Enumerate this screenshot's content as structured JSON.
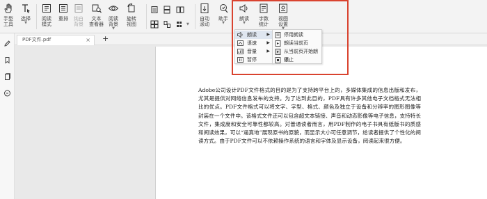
{
  "toolbar": {
    "hand_tool": "手型\n工具",
    "select": "选择",
    "read_mode": "阅读\n模式",
    "reflow": "重排",
    "page_bg": "纯白\n背景",
    "text_viewer": "文本\n查看器",
    "read_bg": "阅读\n背景",
    "rotate_view": "旋转\n视图",
    "auto_scroll": "自动\n滚动",
    "assistant": "助手",
    "read_aloud": "朗读",
    "word_count": "字数\n统计",
    "view_settings": "视图\n设置"
  },
  "read_menu": {
    "items": [
      {
        "label": "朗读",
        "has_submenu": true
      },
      {
        "label": "语速",
        "has_submenu": true
      },
      {
        "label": "音量",
        "has_submenu": true
      },
      {
        "label": "暂停",
        "has_submenu": false
      }
    ]
  },
  "read_submenu": {
    "items": [
      {
        "label": "停用朗读"
      },
      {
        "label": "朗读当前页"
      },
      {
        "label": "从当前页开始朗读"
      },
      {
        "label": "停止"
      }
    ]
  },
  "tabs": {
    "file_name": "PDF文件.pdf",
    "close": "×",
    "add": "+"
  },
  "document": {
    "paragraph": "Adobe公司设计PDF文件格式的目的是为了支持跨平台上的，多媒体集成的信息出版和发布，尤其是提供对网络信息发布的支持。为了达到此目的，PDF具有许多其他电子文档格式无法相比的优点。PDF文件格式可以将文字、字型、格式、颜色及独立于设备和分辨率的图形图像等封装在一个文件中。该格式文件还可以包含超文本链接、声音和动态影像等电子信息，支持特长文件，集成度和安全可靠性都较高。对普通读者而言，用PDF制作的电子书具有纸版书的质感和阅读效果，可以“逼真地”展现原书的原貌，而显示大小可任意调节，给读者提供了个性化的阅读方式。由于PDF文件可以不依赖操作系统的语言和字体及显示设备，阅读起来很方便。"
  },
  "colors": {
    "highlight": "#d9432f",
    "ribbon_bg": "#f3f3f3",
    "menu_selected": "#dfe6f0"
  }
}
